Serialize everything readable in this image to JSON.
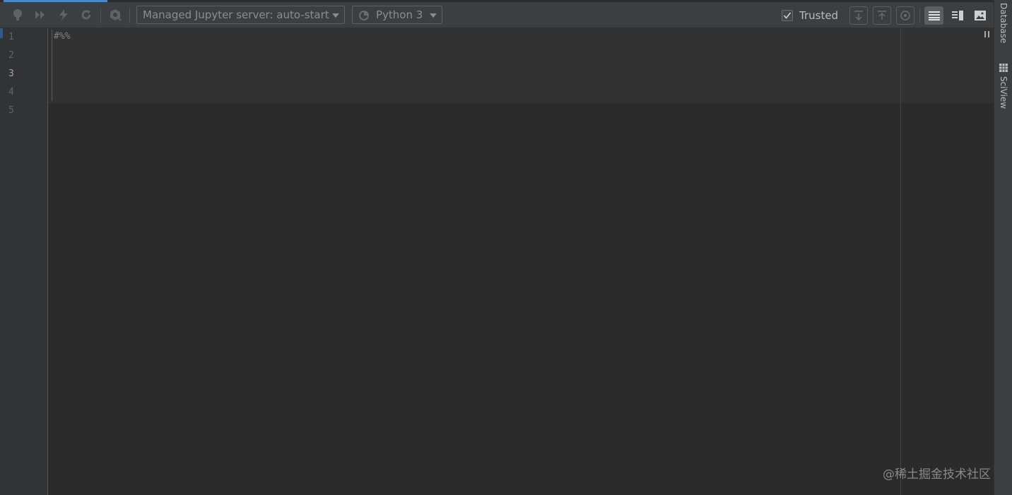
{
  "toolbar": {
    "server_dropdown": "Managed Jupyter server: auto-start",
    "kernel_dropdown": "Python 3",
    "trusted_label": "Trusted",
    "trusted_checked": true
  },
  "editor": {
    "line_numbers": [
      "1",
      "2",
      "3",
      "4",
      "5"
    ],
    "current_line": "3",
    "lines": [
      "#%%",
      "",
      "",
      "",
      ""
    ]
  },
  "side_panel": {
    "tabs": [
      "Database",
      "SciView"
    ]
  },
  "watermark": "@稀土掘金技术社区",
  "colors": {
    "accent": "#4a88c7",
    "background": "#2b2b2b",
    "toolbar": "#3c3f41",
    "gutter": "#313335"
  }
}
